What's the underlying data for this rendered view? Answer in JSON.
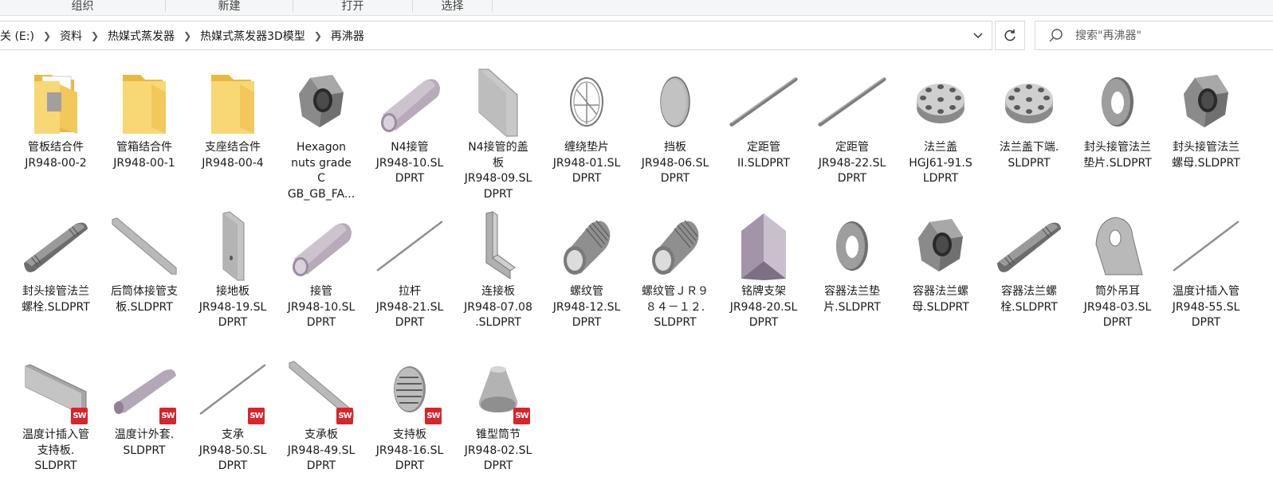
{
  "ribbon": {
    "groups": [
      "组织",
      "新建",
      "打开",
      "选择"
    ]
  },
  "address": {
    "breadcrumbs": [
      "关 (E:)",
      "资料",
      "热媒式蒸发器",
      "热媒式蒸发器3D模型",
      "再沸器"
    ]
  },
  "search": {
    "placeholder": "搜索\"再沸器\""
  },
  "files": [
    {
      "name": "管板结合件\nJR948-00-2",
      "icon": "folder-doc-icon",
      "sw": false
    },
    {
      "name": "管箱结合件\nJR948-00-1",
      "icon": "folder-icon",
      "sw": false
    },
    {
      "name": "支座结合件\nJR948-00-4",
      "icon": "folder-icon",
      "sw": false
    },
    {
      "name": "Hexagon\nnuts grade\nC\nGB_GB_FA...",
      "icon": "hex-nut-icon",
      "sw": false
    },
    {
      "name": "N4接管\nJR948-10.SL\nDPRT",
      "icon": "pipe-icon",
      "sw": false
    },
    {
      "name": "N4接管的盖\n板\nJR948-09.SL\nDPRT",
      "icon": "plate-icon",
      "sw": false
    },
    {
      "name": "缠绕垫片\nJR948-01.SL\nDPRT",
      "icon": "wound-gasket-icon",
      "sw": false
    },
    {
      "name": "挡板\nJR948-06.SL\nDPRT",
      "icon": "disc-icon",
      "sw": false
    },
    {
      "name": "定距管\nII.SLDPRT",
      "icon": "thin-tube-icon",
      "sw": false
    },
    {
      "name": "定距管\nJR948-22.SL\nDPRT",
      "icon": "thin-tube-icon",
      "sw": false
    },
    {
      "name": "法兰盖\nHGJ61-91.S\nLDPRT",
      "icon": "flange-icon",
      "sw": false
    },
    {
      "name": "法兰盖下端.\nSLDPRT",
      "icon": "flange-icon",
      "sw": false
    },
    {
      "name": "封头接管法兰\n垫片.SLDPRT",
      "icon": "washer-icon",
      "sw": false
    },
    {
      "name": "封头接管法兰\n螺母.SLDPRT",
      "icon": "hex-nut-icon",
      "sw": false
    },
    {
      "name": "封头接管法兰\n螺栓.SLDPRT",
      "icon": "stud-bolt-icon",
      "sw": false
    },
    {
      "name": "后筒体接管支\n板.SLDPRT",
      "icon": "bar-icon",
      "sw": false
    },
    {
      "name": "接地板\nJR948-19.SL\nDPRT",
      "icon": "ground-plate-icon",
      "sw": false
    },
    {
      "name": "接管\nJR948-10.SL\nDPRT",
      "icon": "pipe-icon",
      "sw": false
    },
    {
      "name": "拉杆\nJR948-21.SL\nDPRT",
      "icon": "rod-icon",
      "sw": false
    },
    {
      "name": "连接板\nJR948-07.08\n.SLDPRT",
      "icon": "angle-plate-icon",
      "sw": false
    },
    {
      "name": "螺纹管\nJR948-12.SL\nDPRT",
      "icon": "threaded-pipe-icon",
      "sw": false
    },
    {
      "name": "螺纹管ＪＲ９\n８４－１２.\nSLDPRT",
      "icon": "threaded-pipe-icon",
      "sw": false
    },
    {
      "name": "铭牌支架\nJR948-20.SL\nDPRT",
      "icon": "nameplate-bracket-icon",
      "sw": false
    },
    {
      "name": "容器法兰垫\n片.SLDPRT",
      "icon": "washer-icon",
      "sw": false
    },
    {
      "name": "容器法兰螺\n母.SLDPRT",
      "icon": "hex-nut-icon",
      "sw": false
    },
    {
      "name": "容器法兰螺\n栓.SLDPRT",
      "icon": "stud-bolt-icon",
      "sw": false
    },
    {
      "name": "筒外吊耳\nJR948-03.SL\nDPRT",
      "icon": "lifting-lug-icon",
      "sw": false
    },
    {
      "name": "温度计插入管\nJR948-55.SL\nDPRT",
      "icon": "rod-icon",
      "sw": false
    },
    {
      "name": "温度计插入管\n支持板.\nSLDPRT",
      "icon": "channel-plate-icon",
      "sw": true
    },
    {
      "name": "温度计外套.\nSLDPRT",
      "icon": "sleeve-icon",
      "sw": true
    },
    {
      "name": "支承\nJR948-50.SL\nDPRT",
      "icon": "rod-icon",
      "sw": true
    },
    {
      "name": "支承板\nJR948-49.SL\nDPRT",
      "icon": "bar-icon",
      "sw": true
    },
    {
      "name": "支持板\nJR948-16.SL\nDPRT",
      "icon": "perforated-plate-icon",
      "sw": true
    },
    {
      "name": "锥型筒节\nJR948-02.SL\nDPRT",
      "icon": "cone-icon",
      "sw": true
    }
  ],
  "colors": {
    "folder": "#f8d775",
    "metal": "#8c8c8c",
    "pipe": "#b6a9bd",
    "sw_badge": "#d8242b"
  }
}
